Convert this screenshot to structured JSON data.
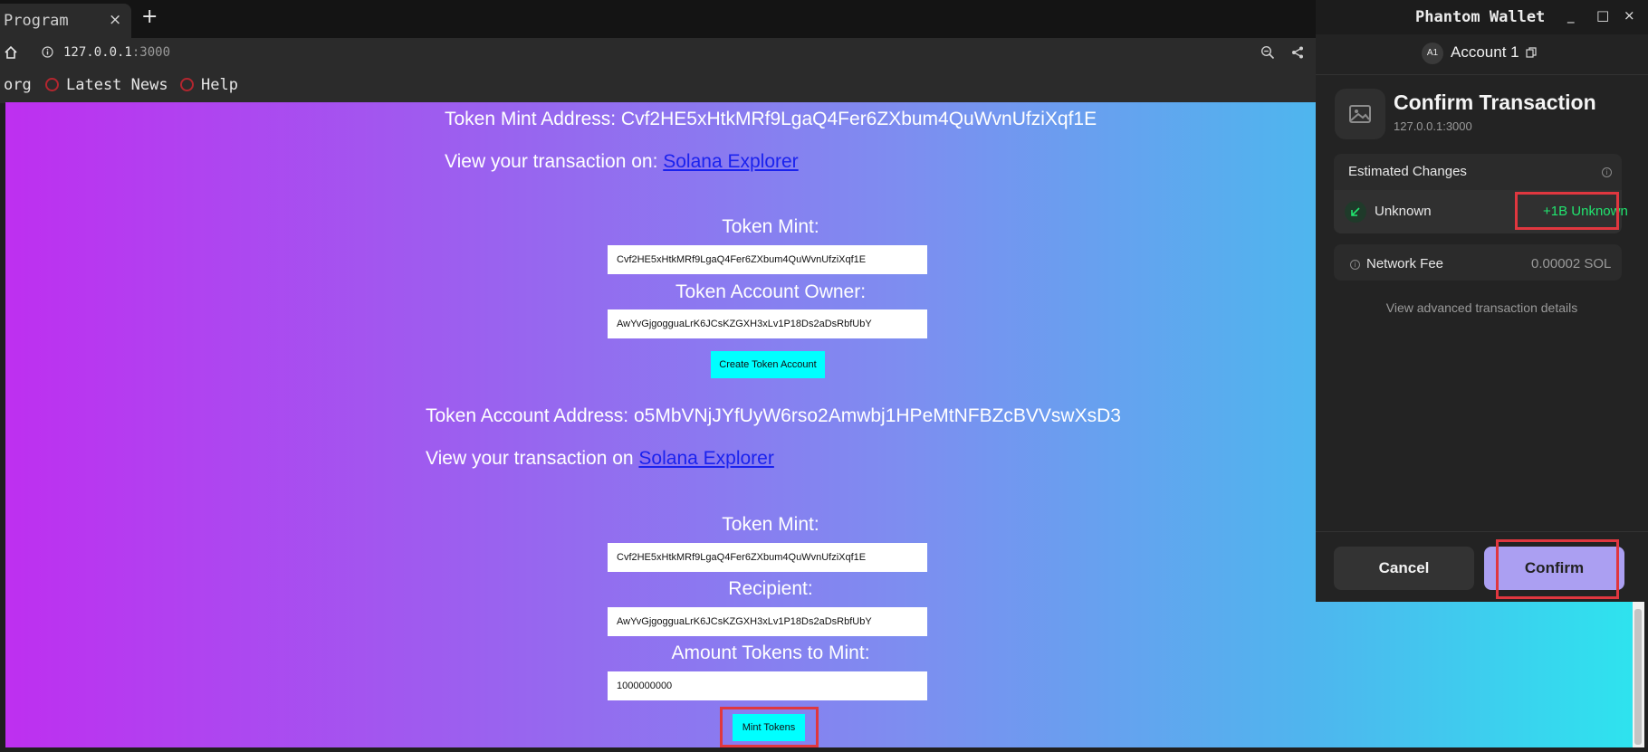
{
  "browser": {
    "tab_title": "Program",
    "tab_close": "×",
    "new_tab": "+",
    "url_host": "127.0.0.1",
    "url_port": ":3000",
    "bookmarks": [
      {
        "label": "org"
      },
      {
        "label": "Latest News"
      },
      {
        "label": "Help"
      }
    ]
  },
  "page": {
    "mint_address_text": "Token Mint Address: Cvf2HE5xHtkMRf9LgaQ4Fer6ZXbum4QuWvnUfziXqf1E",
    "view_tx_prefix_1": "View your transaction on: ",
    "explorer_link_1": "Solana Explorer",
    "create_form": {
      "mint_label": "Token Mint:",
      "mint_value": "Cvf2HE5xHtkMRf9LgaQ4Fer6ZXbum4QuWvnUfziXqf1E",
      "owner_label": "Token Account Owner:",
      "owner_value": "AwYvGjgoggua​LrK6JCsKZGXH3xLv1P18Ds2aDsRbfUbY",
      "button": "Create Token Account"
    },
    "token_account_text": "Token Account Address: o5MbVNjJYfUyW6rso2Amwbj1HPeMtNFBZcBVVswXsD3",
    "view_tx_prefix_2": "View your transaction on ",
    "explorer_link_2": "Solana Explorer",
    "mint_form": {
      "mint_label": "Token Mint:",
      "mint_value": "Cvf2HE5xHtkMRf9LgaQ4Fer6ZXbum4QuWvnUfziXqf1E",
      "recipient_label": "Recipient:",
      "recipient_value": "AwYvGjgogguaLrK6JCsKZGXH3xLv1P18Ds2aDsRbfUbY",
      "amount_label": "Amount Tokens to Mint:",
      "amount_value": "1000000000",
      "button": "Mint Tokens"
    }
  },
  "wallet": {
    "window_title": "Phantom Wallet",
    "controls": [
      "_",
      "□",
      "×"
    ],
    "account_badge": "A1",
    "account_name": "Account 1",
    "heading": "Confirm Transaction",
    "origin": "127.0.0.1:3000",
    "estimated_changes": "Estimated Changes",
    "change_label": "Unknown",
    "change_value": "+1B Unknown",
    "network_fee_label": "Network Fee",
    "network_fee_value": "0.00002 SOL",
    "advanced_link": "View advanced transaction details",
    "cancel": "Cancel",
    "confirm": "Confirm"
  },
  "colors": {
    "accent_confirm": "#ab9ff2",
    "positive_change": "#21e56f",
    "highlight": "#e0373f",
    "page_button": "#00ffff"
  }
}
